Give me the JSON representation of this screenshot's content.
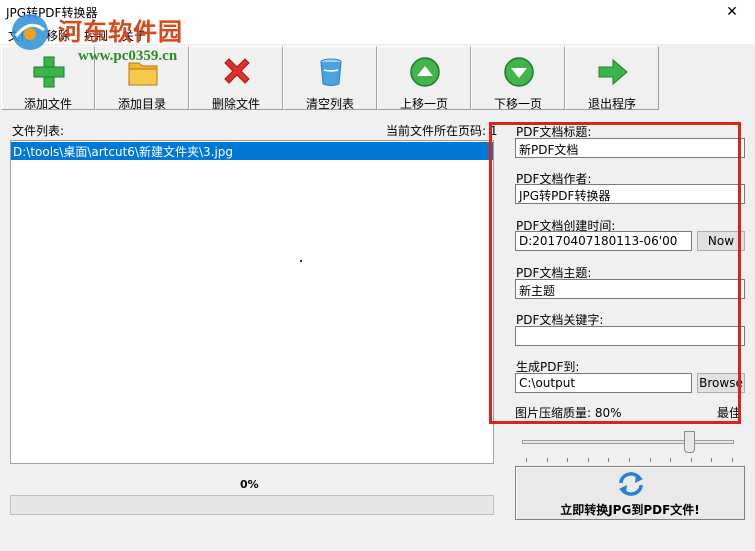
{
  "window": {
    "title": "JPG转PDF转换器",
    "close_glyph": "✕"
  },
  "menu": [
    "文件",
    "移除",
    "控制",
    "关于"
  ],
  "watermark": {
    "title": "河东软件园",
    "url": "www.pc0359.cn"
  },
  "toolbar": [
    {
      "label": "添加文件",
      "icon": "add-plus-icon"
    },
    {
      "label": "添加目录",
      "icon": "folder-icon"
    },
    {
      "label": "删除文件",
      "icon": "delete-x-icon"
    },
    {
      "label": "清空列表",
      "icon": "clear-bucket-icon"
    },
    {
      "label": "上移一页",
      "icon": "arrow-up-icon"
    },
    {
      "label": "下移一页",
      "icon": "arrow-down-icon"
    },
    {
      "label": "退出程序",
      "icon": "exit-arrow-icon"
    }
  ],
  "file_list": {
    "label": "文件列表:",
    "current_page_label": "当前文件所在页码: 1",
    "items": [
      "D:\\tools\\桌面\\artcut6\\新建文件夹\\3.jpg"
    ]
  },
  "progress": {
    "text": "0%",
    "value": 0
  },
  "pdf": {
    "title_label": "PDF文档标题:",
    "title_value": "新PDF文档",
    "author_label": "PDF文档作者:",
    "author_value": "JPG转PDF转换器",
    "created_label": "PDF文档创建时间:",
    "created_value": "D:20170407180113-06'00",
    "now_button": "Now",
    "subject_label": "PDF文档主题:",
    "subject_value": "新主题",
    "keywords_label": "PDF文档关键字:",
    "keywords_value": "",
    "output_label": "生成PDF到:",
    "output_value": "C:\\output",
    "browse_button": "Browse",
    "quality_label": "图片压缩质量: 80%",
    "quality_value": 80,
    "best_label": "最佳"
  },
  "convert_button": "立即转换JPG到PDF文件!",
  "colors": {
    "highlight": "#e0201b",
    "selection": "#0078d7",
    "watermark_title": "#d8481b",
    "watermark_url": "#2a8a2a"
  }
}
